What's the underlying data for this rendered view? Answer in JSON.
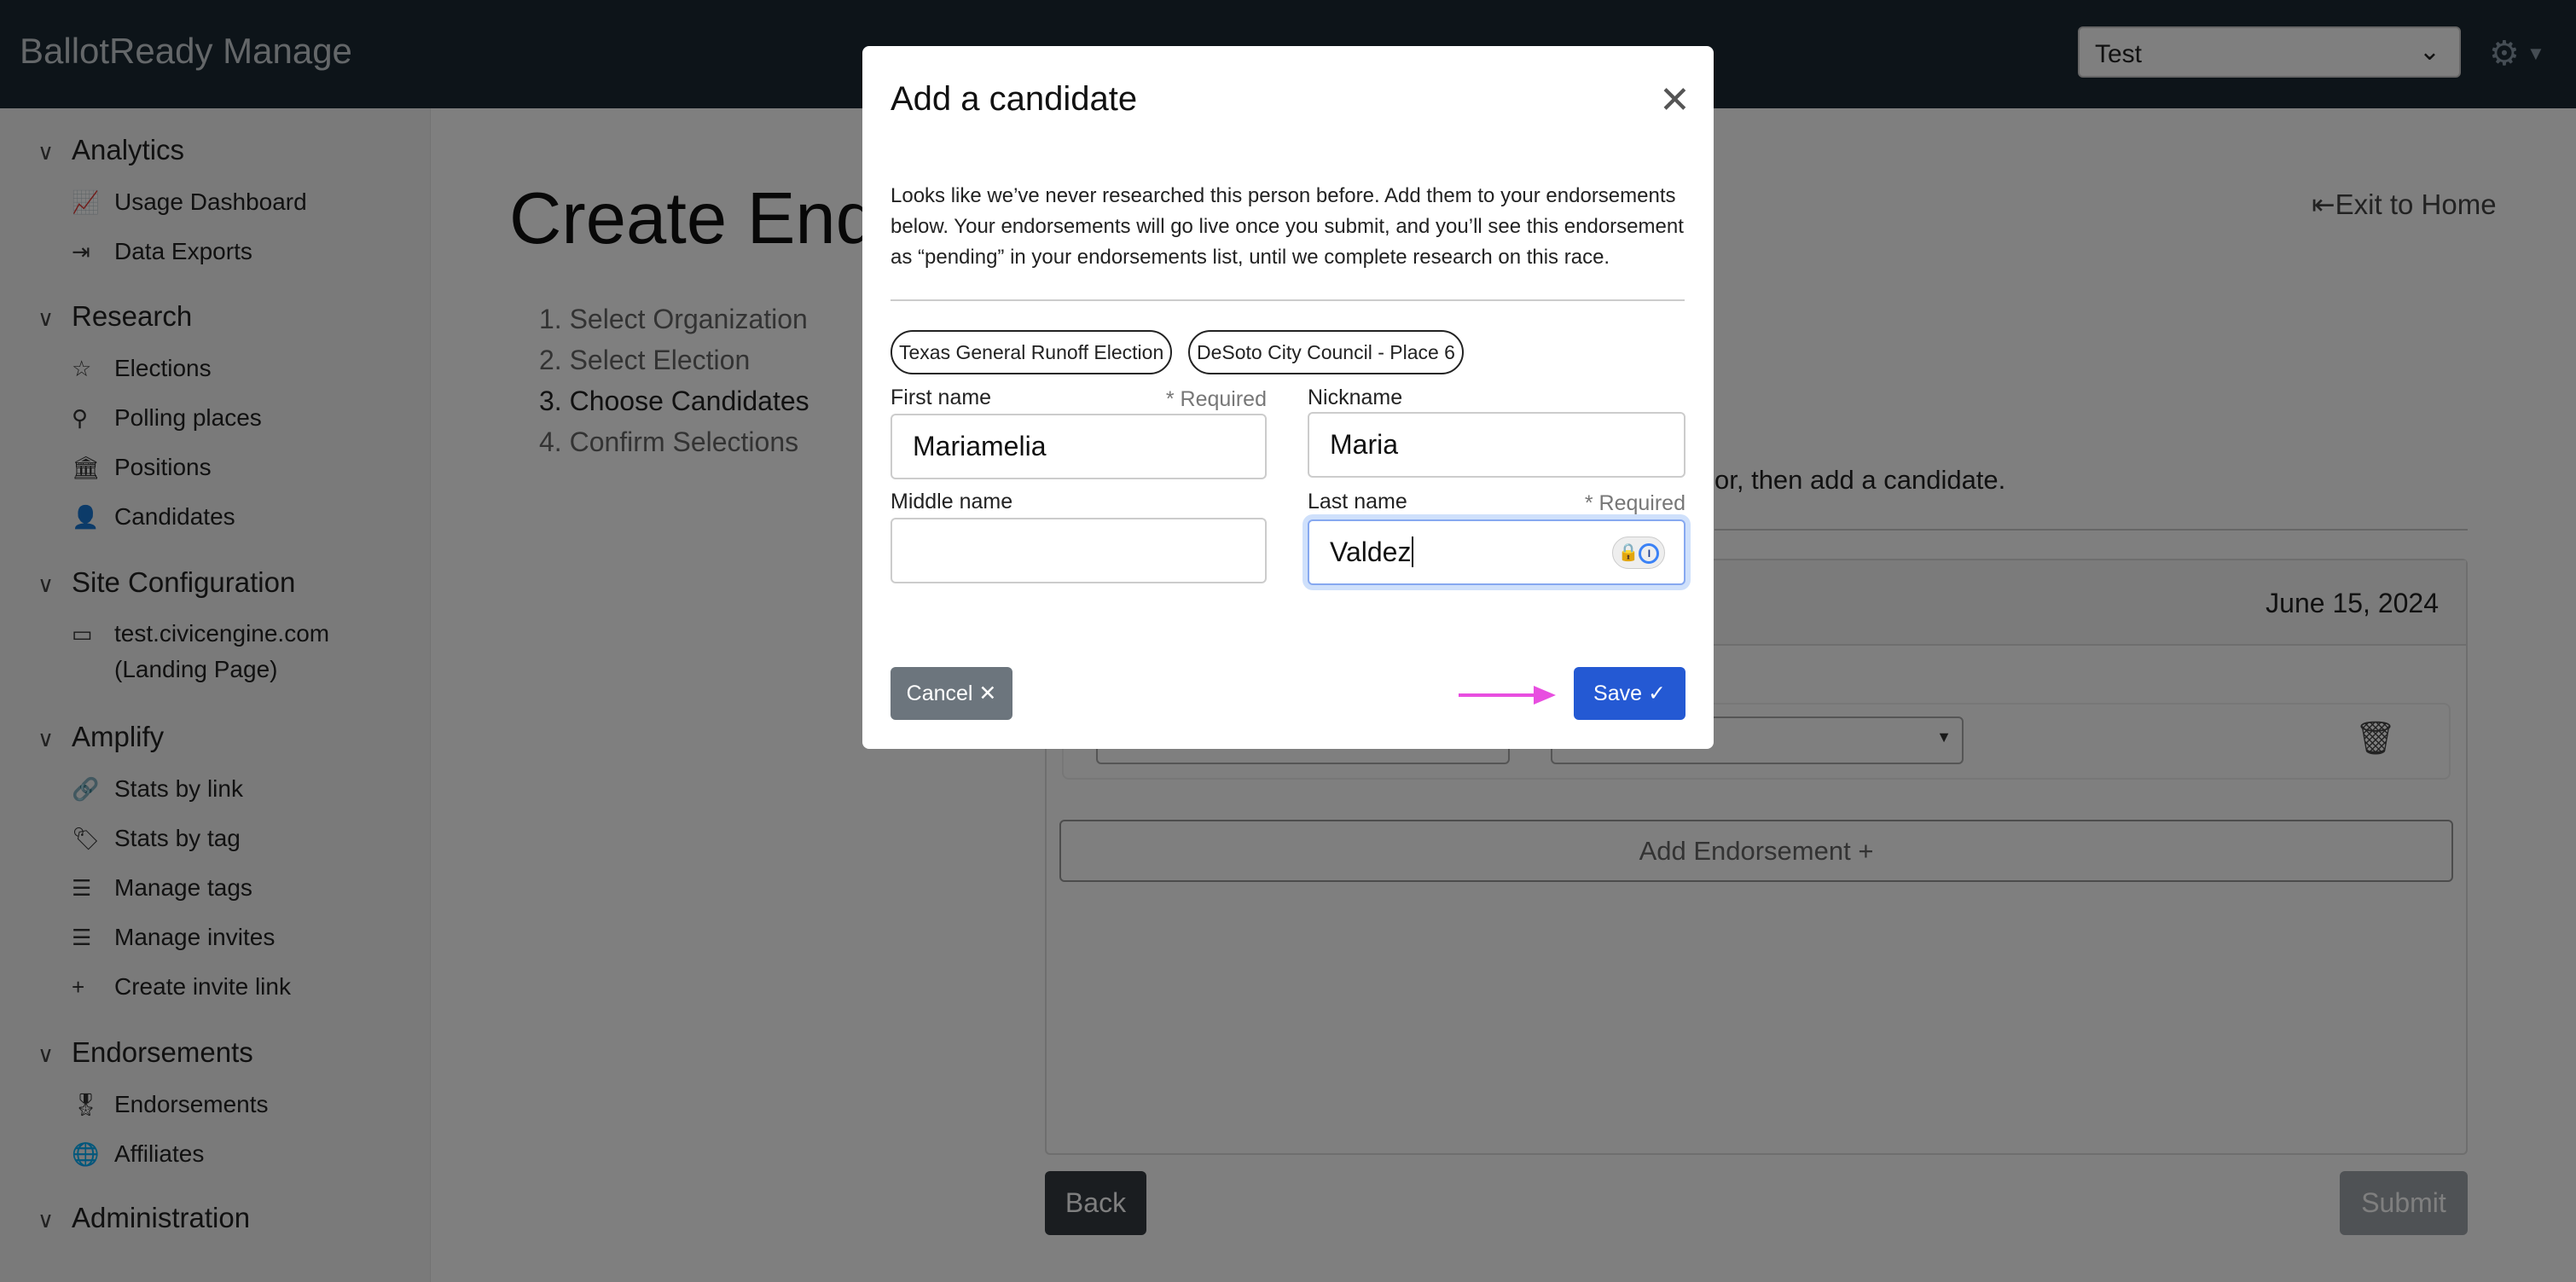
{
  "header": {
    "brand": "BallotReady Manage",
    "org_select": "Test"
  },
  "sidebar": {
    "sections": [
      {
        "label": "Analytics",
        "items": [
          {
            "label": "Usage Dashboard",
            "icon": "chart-line-icon"
          },
          {
            "label": "Data Exports",
            "icon": "file-export-icon"
          }
        ]
      },
      {
        "label": "Research",
        "items": [
          {
            "label": "Elections",
            "icon": "star-icon"
          },
          {
            "label": "Polling places",
            "icon": "map-pin-icon"
          },
          {
            "label": "Positions",
            "icon": "building-icon"
          },
          {
            "label": "Candidates",
            "icon": "person-icon"
          }
        ]
      },
      {
        "label": "Site Configuration",
        "items": [
          {
            "label": "test.civicengine.com",
            "label2": "(Landing Page)",
            "icon": "browser-window-icon"
          }
        ]
      },
      {
        "label": "Amplify",
        "items": [
          {
            "label": "Stats by link",
            "icon": "link-icon"
          },
          {
            "label": "Stats by tag",
            "icon": "tag-icon"
          },
          {
            "label": "Manage tags",
            "icon": "list-icon"
          },
          {
            "label": "Manage invites",
            "icon": "list-icon"
          },
          {
            "label": "Create invite link",
            "icon": "plus-icon"
          }
        ]
      },
      {
        "label": "Endorsements",
        "items": [
          {
            "label": "Endorsements",
            "icon": "award-icon"
          },
          {
            "label": "Affiliates",
            "icon": "globe-icon"
          }
        ]
      },
      {
        "label": "Administration",
        "items": []
      }
    ]
  },
  "main": {
    "title": "Create Endo",
    "steps": [
      "1. Select Organization",
      "2. Select Election",
      "3. Choose Candidates",
      "4. Confirm Selections"
    ],
    "exit": "Exit to Home",
    "hint": "or, then add a candidate.",
    "date": "June 15, 2024",
    "add_endorsement": "Add Endorsement +",
    "back": "Back",
    "submit": "Submit"
  },
  "modal": {
    "title": "Add a candidate",
    "text": "Looks like we’ve never researched this person before. Add them to your endorsements below. Your endorsements will go live once you submit, and you’ll see this endorsement as “pending” in your endorsements list, until we complete research on this race.",
    "chips": [
      "Texas General Runoff Election",
      "DeSoto City Council - Place 6"
    ],
    "first_name": {
      "label": "First name",
      "required": "* Required",
      "value": "Mariamelia"
    },
    "nickname": {
      "label": "Nickname",
      "value": "Maria"
    },
    "middle_name": {
      "label": "Middle name",
      "value": ""
    },
    "last_name": {
      "label": "Last name",
      "required": "* Required",
      "value": "Valdez"
    },
    "cancel": "Cancel ✕",
    "save": "Save ✓"
  },
  "colors": {
    "header": "#1b2833",
    "save": "#2459d3",
    "cancel": "#6c757d",
    "arrow": "#e84ee0"
  }
}
